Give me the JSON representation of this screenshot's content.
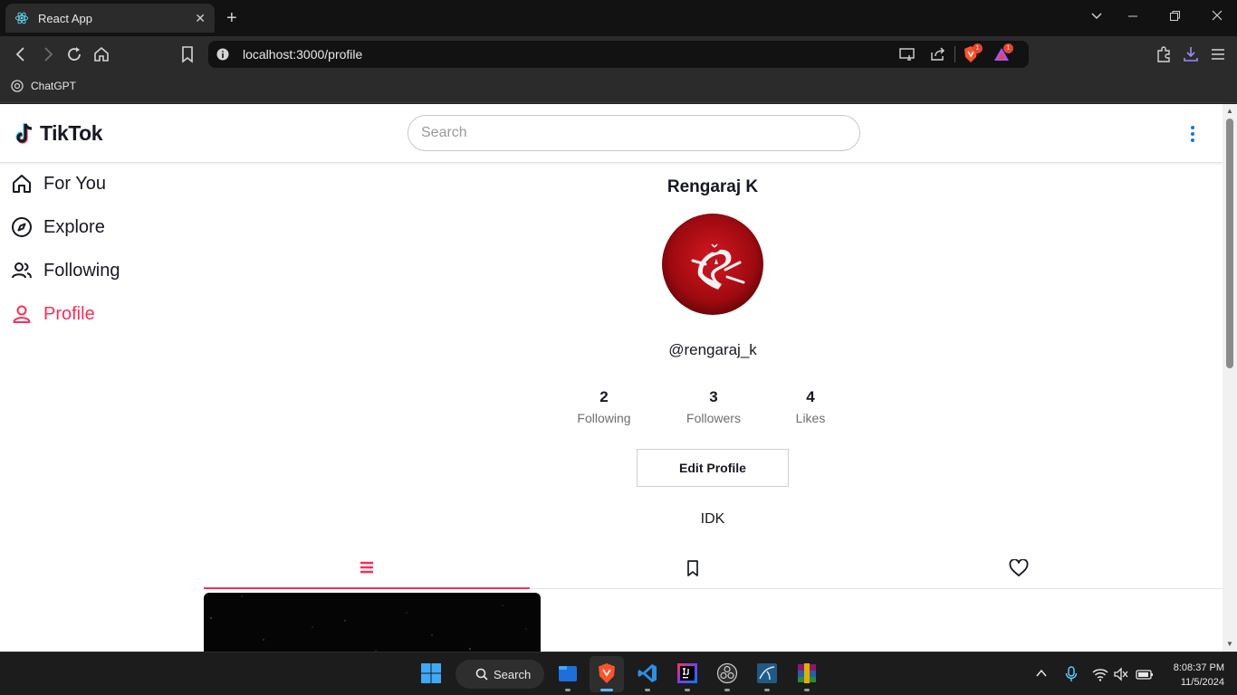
{
  "browser": {
    "tab_title": "React App",
    "url": "localhost:3000/profile",
    "bookmark": "ChatGPT",
    "brave_badge": "1",
    "rewards_badge": "1"
  },
  "header": {
    "logo_text": "TikTok",
    "search_placeholder": "Search"
  },
  "sidebar": {
    "items": [
      {
        "label": "For You",
        "icon": "home-icon",
        "active": false
      },
      {
        "label": "Explore",
        "icon": "compass-icon",
        "active": false
      },
      {
        "label": "Following",
        "icon": "users-icon",
        "active": false
      },
      {
        "label": "Profile",
        "icon": "user-icon",
        "active": true
      }
    ]
  },
  "profile": {
    "name": "Rengaraj K",
    "username": "@rengaraj_k",
    "stats": [
      {
        "value": "2",
        "label": "Following"
      },
      {
        "value": "3",
        "label": "Followers"
      },
      {
        "value": "4",
        "label": "Likes"
      }
    ],
    "edit_button": "Edit Profile",
    "bio": "IDK",
    "tabs": [
      {
        "icon": "list-icon",
        "active": true
      },
      {
        "icon": "bookmark-icon",
        "active": false
      },
      {
        "icon": "heart-icon",
        "active": false
      }
    ]
  },
  "taskbar": {
    "search_label": "Search",
    "time": "8:08:37 PM",
    "date": "11/5/2024"
  },
  "colors": {
    "accent": "#fe2c55",
    "text": "#161823"
  }
}
